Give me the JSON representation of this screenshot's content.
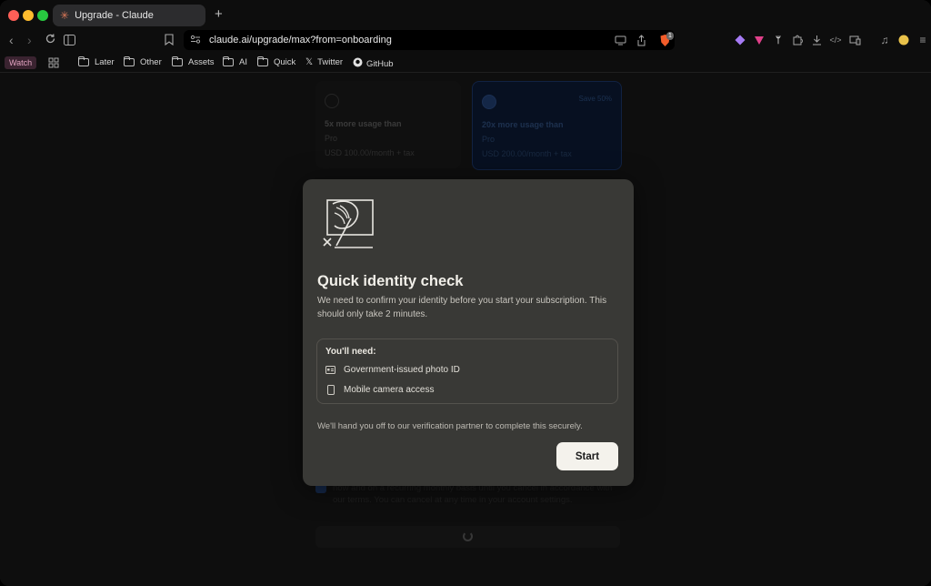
{
  "browser": {
    "tab_title": "Upgrade - Claude",
    "new_tab": "+",
    "url": "claude.ai/upgrade/max?from=onboarding",
    "traffic_colors": [
      "#fe5f57",
      "#febc2e",
      "#28c840"
    ],
    "brave_badge": "1"
  },
  "bookmarks": {
    "watch": "Watch",
    "items": [
      "Later",
      "Other",
      "Assets",
      "AI",
      "Quick",
      "Twitter",
      "GitHub"
    ]
  },
  "background": {
    "plan1": {
      "head": "5x more usage than",
      "line": "Pro",
      "price": "USD 100.00/month + tax"
    },
    "plan2": {
      "head": "20x more usage than",
      "line": "Pro",
      "price": "USD 200.00/month + tax",
      "badge": "Save 50%"
    },
    "terms": "now and on a recurring monthly basis until you cancel in accordance with our terms. You can cancel at any time in your account settings."
  },
  "modal": {
    "title": "Quick identity check",
    "description": "We need to confirm your identity before you start your subscription. This should only take 2 minutes.",
    "need_title": "You'll need:",
    "needs": [
      "Government-issued photo ID",
      "Mobile camera access"
    ],
    "footer": "We'll hand you off to our verification partner to complete this securely.",
    "start_label": "Start"
  },
  "colors": {
    "accent_bg": "#393936",
    "start_bg": "#f4f2ec",
    "plan_selected": "#0b1a34"
  }
}
